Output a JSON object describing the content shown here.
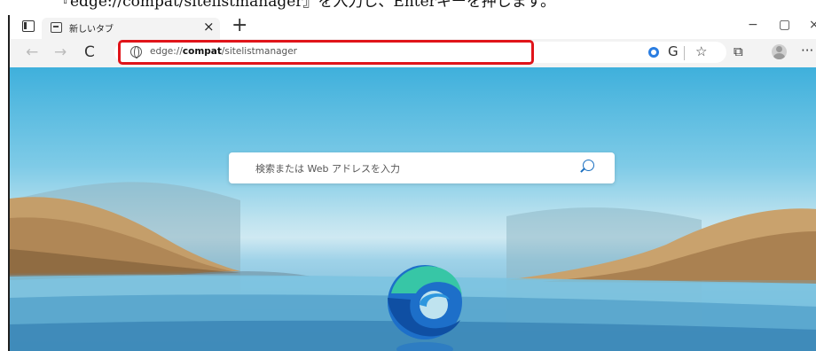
{
  "caption": "『edge://compat/sitelistmanager』を入力し、Enterキーを押します。",
  "tab": {
    "title": "新しいタブ",
    "close": "×",
    "new_tab": "+"
  },
  "window_controls": {
    "minimize": "−",
    "maximize": "▢",
    "close": "×"
  },
  "nav": {
    "back": "←",
    "forward": "→",
    "refresh": "C"
  },
  "address": {
    "prefix": "edge://",
    "host": "compat",
    "path": "/sitelistmanager"
  },
  "toolbar_icons": {
    "collections_sync": "G",
    "favorites": "☆",
    "collections": "⧉",
    "more": "···"
  },
  "search": {
    "placeholder": "検索または Web アドレスを入力"
  },
  "colors": {
    "highlight": "#e0141a",
    "accent": "#1a6fc0"
  }
}
